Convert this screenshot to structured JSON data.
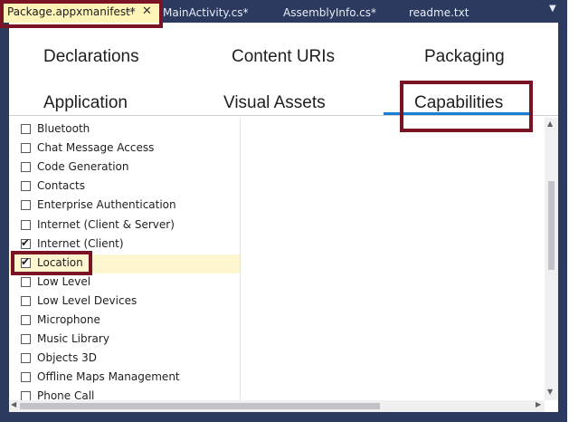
{
  "tabs": [
    {
      "label": "Package.appxmanifest*",
      "active": true
    },
    {
      "label": "MainActivity.cs*",
      "active": false
    },
    {
      "label": "AssemblyInfo.cs*",
      "active": false
    },
    {
      "label": "readme.txt",
      "active": false
    }
  ],
  "tab_pin_glyph": "⊣",
  "tab_close_glyph": "✕",
  "tab_dropdown_glyph": "▼",
  "nav": {
    "declarations": "Declarations",
    "content_uris": "Content URIs",
    "packaging": "Packaging",
    "application": "Application",
    "visual_assets": "Visual Assets",
    "capabilities": "Capabilities",
    "active": "Capabilities"
  },
  "capabilities": [
    {
      "label": "Bluetooth",
      "checked": false
    },
    {
      "label": "Chat Message Access",
      "checked": false
    },
    {
      "label": "Code Generation",
      "checked": false
    },
    {
      "label": "Contacts",
      "checked": false
    },
    {
      "label": "Enterprise Authentication",
      "checked": false
    },
    {
      "label": "Internet (Client & Server)",
      "checked": false
    },
    {
      "label": "Internet (Client)",
      "checked": true
    },
    {
      "label": "Location",
      "checked": true,
      "selected": true
    },
    {
      "label": "Low Level",
      "checked": false
    },
    {
      "label": "Low Level Devices",
      "checked": false
    },
    {
      "label": "Microphone",
      "checked": false
    },
    {
      "label": "Music Library",
      "checked": false
    },
    {
      "label": "Objects 3D",
      "checked": false
    },
    {
      "label": "Offline Maps Management",
      "checked": false
    },
    {
      "label": "Phone Call",
      "checked": false
    }
  ],
  "colors": {
    "chrome": "#2b3a5e",
    "active_tab": "#fff4b8",
    "highlight_box": "#7a1424",
    "nav_underline": "#1a7fd4",
    "selected_row": "#fdf6cf"
  }
}
